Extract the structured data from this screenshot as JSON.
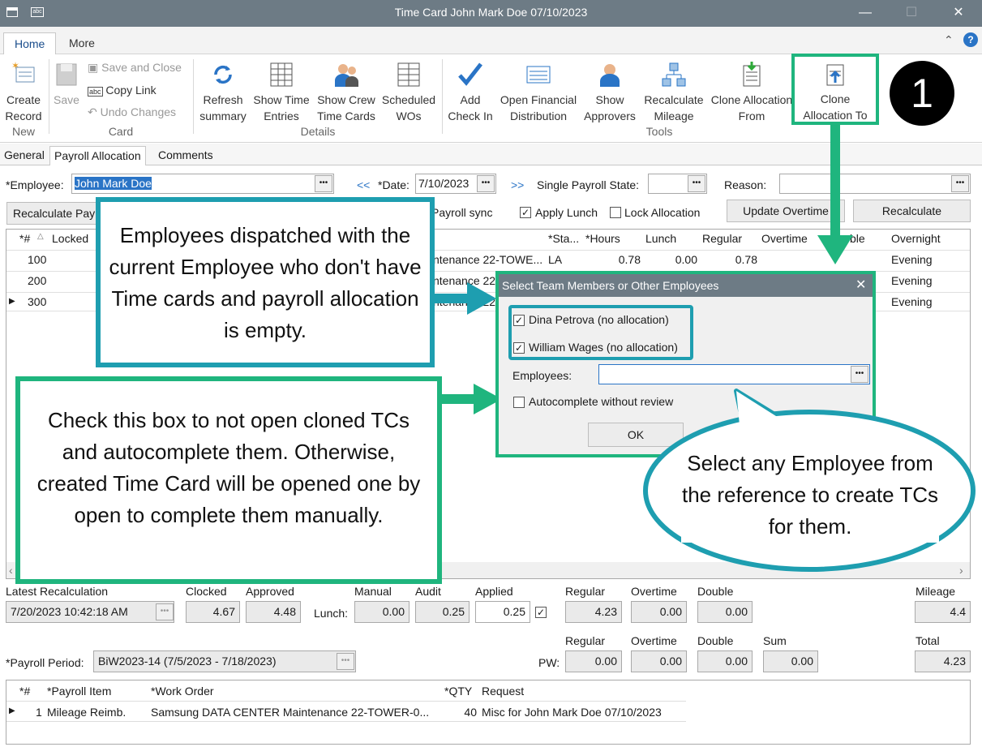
{
  "window": {
    "title": "Time Card John Mark Doe 07/10/2023"
  },
  "ribbon_tabs": [
    "Home",
    "More"
  ],
  "ribbon": {
    "create_record": "Create Record",
    "save": "Save",
    "save_close": "Save and Close",
    "copy_link": "Copy Link",
    "undo": "Undo Changes",
    "refresh": "Refresh summary",
    "show_time": "Show Time Entries",
    "show_crew": "Show Crew Time Cards",
    "scheduled": "Scheduled WOs",
    "add_checkin": "Add Check In",
    "open_fin": "Open Financial Distribution",
    "show_approvers": "Show Approvers",
    "recalc_mileage": "Recalculate Mileage",
    "clone_from": "Clone Allocation From",
    "clone_to": "Clone Allocation To",
    "groups": [
      "New",
      "Card",
      "Details",
      "Tools"
    ]
  },
  "step_badge": "1",
  "subtabs": [
    "General",
    "Payroll Allocation",
    "Comments"
  ],
  "form": {
    "employee_label": "*Employee:",
    "employee_value": "John Mark Doe",
    "prev": "<<",
    "date_label": "*Date:",
    "date_value": "7/10/2023",
    "next": ">>",
    "state_label": "Single Payroll State:",
    "reason_label": "Reason:",
    "recalc_pay": "Recalculate Pay",
    "payroll_sync": "Payroll sync",
    "apply_lunch": "Apply Lunch",
    "lock_alloc": "Lock Allocation",
    "update_ot": "Update Overtime",
    "recalculate": "Recalculate"
  },
  "grid": {
    "headers": [
      "*#",
      "Locked",
      "*Sta...",
      "*Hours",
      "Lunch",
      "Regular",
      "Overtime",
      "ble",
      "Overnight"
    ],
    "rows": [
      {
        "n": "100",
        "wo": "ntenance 22-TOWE...",
        "st": "LA",
        "hours": "0.78",
        "lunch": "0.00",
        "reg": "0.78",
        "night": "Evening"
      },
      {
        "n": "200",
        "wo": "ntenance 22",
        "st": "",
        "hours": "",
        "lunch": "",
        "reg": "",
        "night": "Evening"
      },
      {
        "n": "300",
        "wo": "ntenance 22",
        "st": "",
        "hours": "",
        "lunch": "",
        "reg": "",
        "night": "Evening"
      }
    ]
  },
  "dialog": {
    "title": "Select Team Members or Other Employees",
    "m1": "Dina Petrova (no allocation)",
    "m2": "William Wages (no allocation)",
    "emp_label": "Employees:",
    "auto": "Autocomplete without review",
    "ok": "OK"
  },
  "callouts": {
    "c1": "Employees dispatched with the current Employee who don't have Time cards and payroll allocation is empty.",
    "c2": "Check this box to not open cloned TCs and autocomplete them. Otherwise, created Time Card will be opened one by open to complete them manually.",
    "c3": "Select any Employee from the reference to create TCs for them."
  },
  "summary": {
    "latest_label": "Latest Recalculation",
    "latest_value": "7/20/2023 10:42:18 AM",
    "clocked_label": "Clocked",
    "clocked": "4.67",
    "approved_label": "Approved",
    "approved": "4.48",
    "lunch_label": "Lunch:",
    "manual_label": "Manual",
    "manual": "0.00",
    "audit_label": "Audit",
    "audit": "0.25",
    "applied_label": "Applied",
    "applied": "0.25",
    "regular_label": "Regular",
    "regular": "4.23",
    "overtime_label": "Overtime",
    "overtime": "0.00",
    "double_label": "Double",
    "double": "0.00",
    "mileage_label": "Mileage",
    "mileage": "4.4",
    "period_label": "*Payroll Period:",
    "period_value": "BiW2023-14 (7/5/2023 - 7/18/2023)",
    "pw_label": "PW:",
    "pw_regular": "0.00",
    "pw_overtime": "0.00",
    "pw_double": "0.00",
    "sum_label": "Sum",
    "pw_sum": "0.00",
    "total_label": "Total",
    "total": "4.23"
  },
  "items": {
    "headers": [
      "*#",
      "*Payroll Item",
      "*Work Order",
      "*QTY",
      "Request"
    ],
    "row": {
      "n": "1",
      "item": "Mileage Reimb.",
      "wo": "Samsung DATA CENTER Maintenance 22-TOWER-0...",
      "qty": "40",
      "req": "Misc for John Mark Doe 07/10/2023"
    }
  }
}
